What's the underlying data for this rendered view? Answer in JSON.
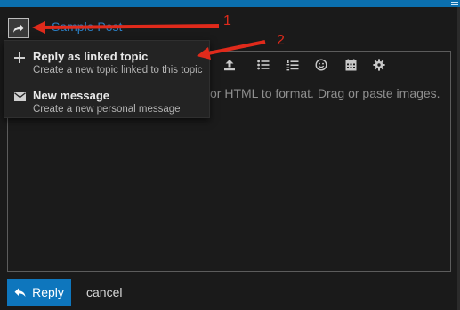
{
  "composer": {
    "topic_title": "Sample Post",
    "placeholder": "or HTML to format. Drag or paste images."
  },
  "reply_menu": {
    "items": [
      {
        "icon": "plus-icon",
        "title": "Reply as linked topic",
        "description": "Create a new topic linked to this topic"
      },
      {
        "icon": "envelope-icon",
        "title": "New message",
        "description": "Create a new personal message"
      }
    ]
  },
  "toolbar": {
    "buttons": [
      "upload-icon",
      "bullet-list-icon",
      "numbered-list-icon",
      "emoji-icon",
      "calendar-icon",
      "gear-icon"
    ]
  },
  "footer": {
    "reply_label": "Reply",
    "cancel_label": "cancel"
  },
  "annotations": {
    "label_1": "1",
    "label_2": "2",
    "color": "#e02a1b"
  },
  "colors": {
    "accent": "#0e76bd",
    "link": "#2a7fc4",
    "background": "#1a1a1a"
  }
}
